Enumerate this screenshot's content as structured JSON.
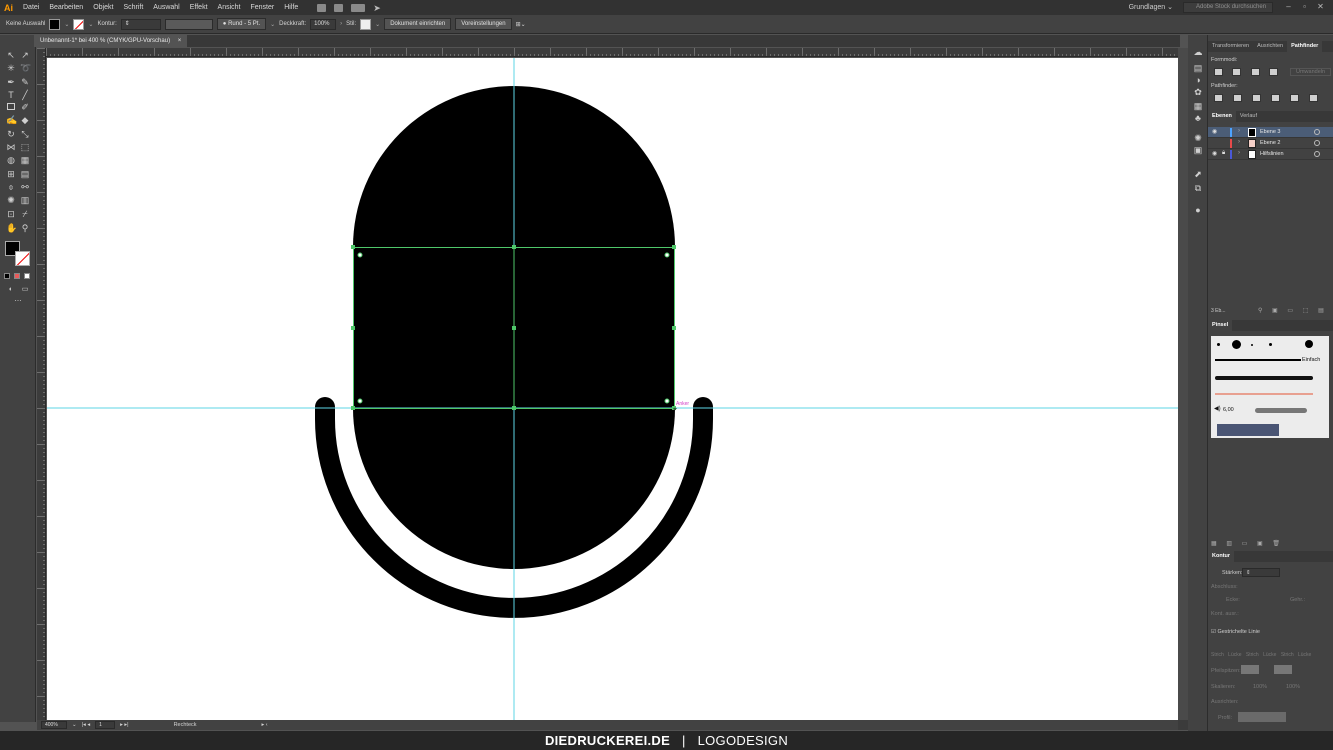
{
  "app": {
    "logo": "Ai",
    "menus": [
      "Datei",
      "Bearbeiten",
      "Objekt",
      "Schrift",
      "Auswahl",
      "Effekt",
      "Ansicht",
      "Fenster",
      "Hilfe"
    ],
    "workspace": "Grundlagen",
    "stock_search_placeholder": "Adobe Stock durchsuchen"
  },
  "controlbar": {
    "selection": "Keine Auswahl",
    "stroke_label": "Kontur:",
    "brush": "Rund - 5 Pt.",
    "opacity_label": "Deckkraft:",
    "opacity_value": "100%",
    "style_label": "Stil:",
    "doc_setup": "Dokument einrichten",
    "preferences": "Voreinstellungen"
  },
  "document": {
    "tab_title": "Unbenannt-1* bei 400 % (CMYK/GPU-Vorschau)",
    "close": "×"
  },
  "canvas": {
    "anchor_hint": "Anker",
    "fill_color": "#000000",
    "guide_color": "#5ed6e6",
    "bbox_color": "#4fc76a",
    "hint_color": "#d23fc6"
  },
  "status": {
    "zoom": "400%",
    "artboard": "1",
    "tool": "Rechteck"
  },
  "brand": {
    "bold": "DIEDRUCKEREI.DE",
    "separator": "|",
    "light": "LOGODESIGN"
  },
  "panels": {
    "top_tabs": [
      "Transformieren",
      "Ausrichten",
      "Pathfinder"
    ],
    "formmodi": "Formmodi:",
    "umwandeln": "Umwandeln",
    "pathfinder": "Pathfinder:",
    "layer_tabs": [
      "Ebenen",
      "Verlauf"
    ],
    "layers": [
      {
        "name": "Ebene 3",
        "color": "#4da3ff",
        "selected": true
      },
      {
        "name": "Ebene 2",
        "color": "#e84a4a",
        "selected": false
      },
      {
        "name": "Hilfslinien",
        "color": "#4a58d8",
        "selected": false
      }
    ],
    "layers_count": "3 Eb...",
    "brush_tab": "Pinsel",
    "brush_einfach": "Einfach",
    "brush_size": "6,00",
    "kontur_tab": "Kontur",
    "starke_label": "Stärken:",
    "abschluss": "Abschluss:",
    "ecke": "Ecke:",
    "gehrung": "Gehr.:",
    "kontur_ausr": "Kont. ausr.:",
    "gestrichelte": "Gestrichelte Linie",
    "dash_labels": [
      "Strich",
      "Lücke",
      "Strich",
      "Lücke",
      "Strich",
      "Lücke"
    ],
    "pfeilspitzen": "Pfeilspitzen:",
    "skalieren": "Skalieren:",
    "scale1": "100%",
    "scale2": "100%",
    "ausrichten": "Ausrichten:",
    "profil": "Profil:"
  }
}
